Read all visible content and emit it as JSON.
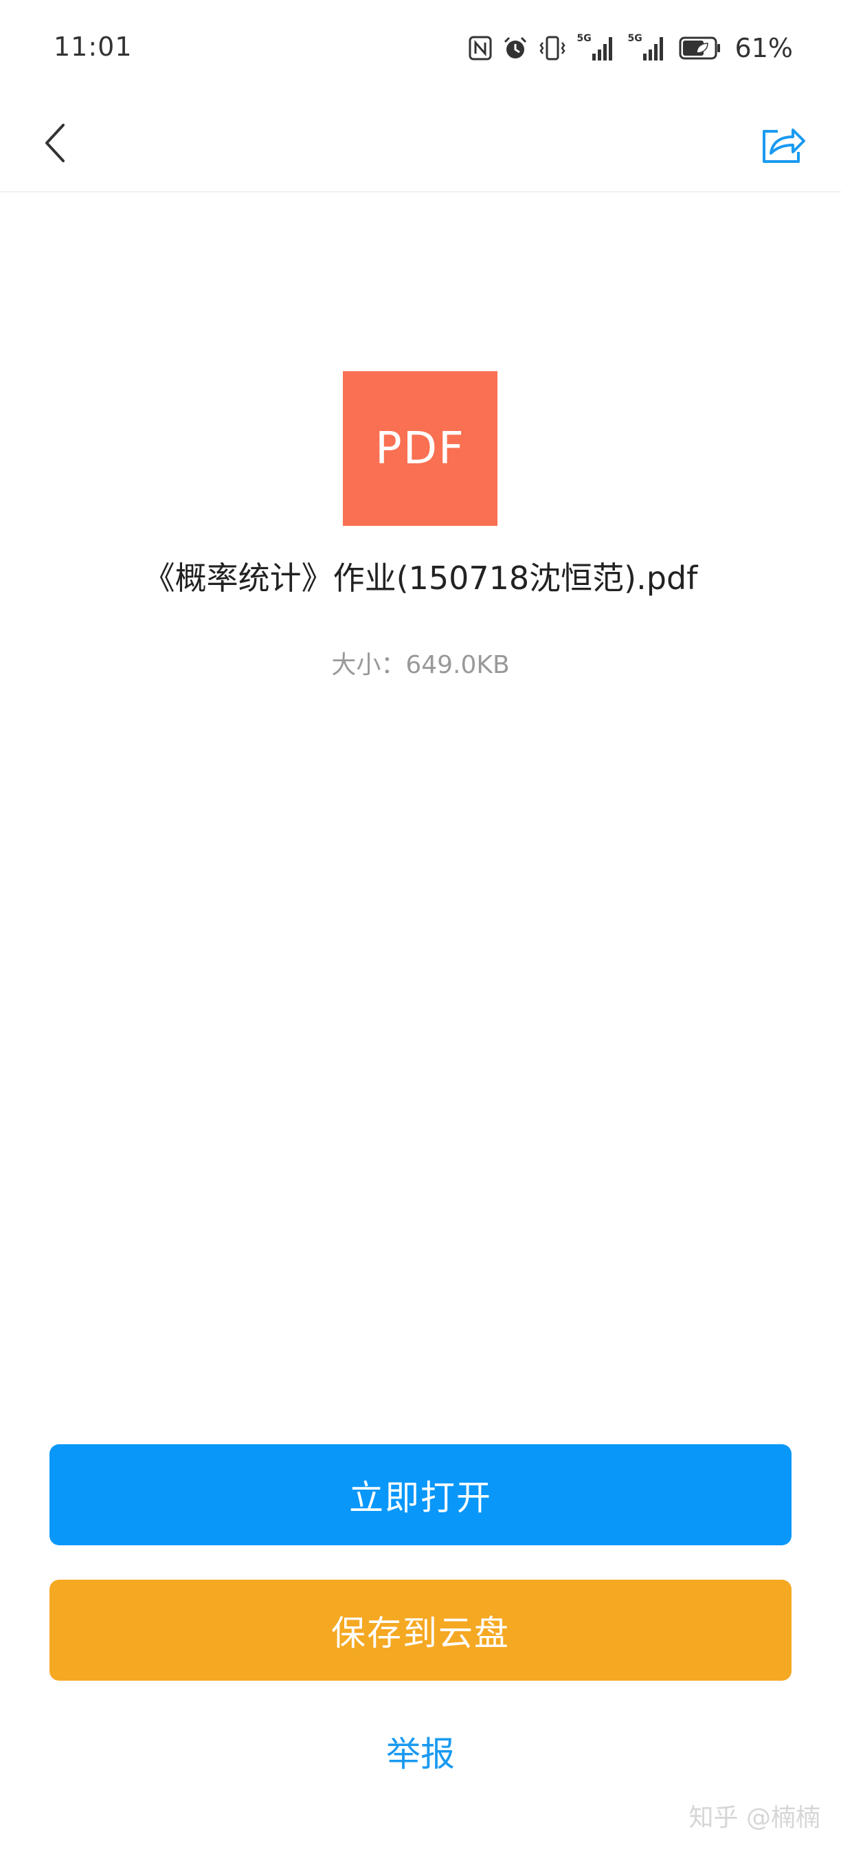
{
  "status_bar": {
    "time": "11:01",
    "signal_1_label": "5G",
    "signal_2_label": "5G",
    "battery_percent": "61%"
  },
  "nav": {
    "back_icon": "chevron-left-icon",
    "share_icon": "share-icon"
  },
  "file": {
    "type_label": "PDF",
    "name": "《概率统计》作业(150718沈恒范).pdf",
    "size": "大小：649.0KB"
  },
  "actions": {
    "open_label": "立即打开",
    "save_label": "保存到云盘",
    "report_label": "举报"
  },
  "watermark": "知乎 @楠楠",
  "colors": {
    "pdf_icon": "#F97052",
    "open_button": "#0997FA",
    "save_button": "#F5A822",
    "accent": "#1A9AF1"
  }
}
